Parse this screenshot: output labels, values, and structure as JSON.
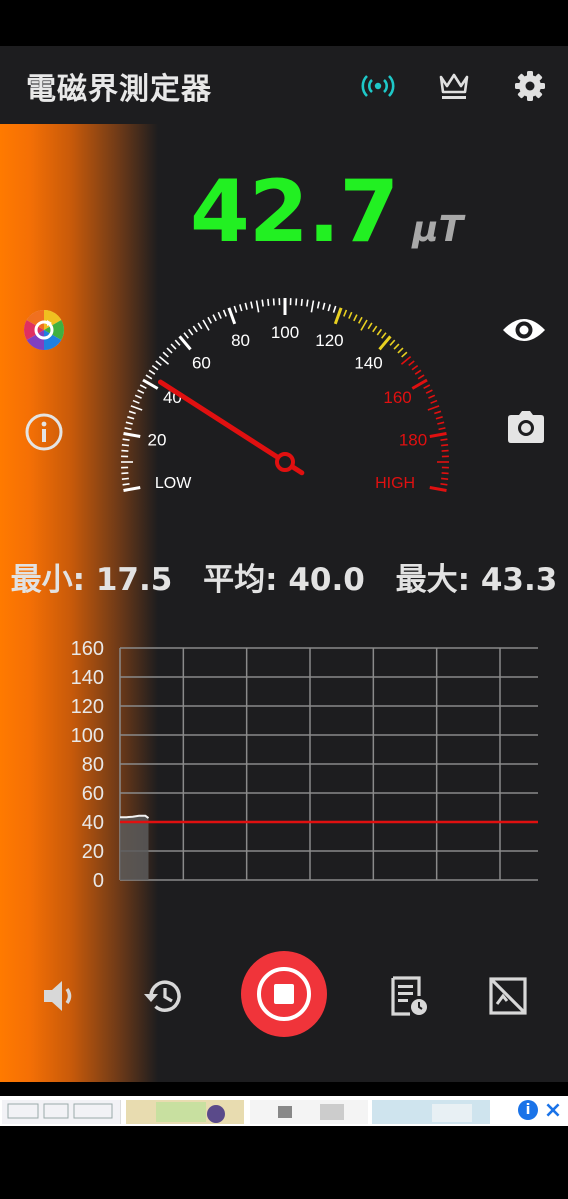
{
  "header": {
    "title": "電磁界測定器"
  },
  "icons": {
    "signal": "signal-broadcast-icon",
    "premium": "crown-icon",
    "settings": "gear-icon",
    "calibrate": "color-wheel-icon",
    "info": "info-icon",
    "view": "eye-icon",
    "camera": "camera-icon",
    "sound": "speaker-icon",
    "history": "history-icon",
    "report": "report-icon",
    "no_overlay": "no-overlay-icon"
  },
  "reading": {
    "value": "42.7",
    "unit": "μT"
  },
  "gauge": {
    "ticks": [
      "20",
      "40",
      "60",
      "80",
      "100",
      "120",
      "140",
      "160",
      "180"
    ],
    "low_label": "LOW",
    "high_label": "HIGH",
    "min": 0,
    "max": 200,
    "needle_value": 42.7
  },
  "stats": {
    "min_label": "最小: 17.5",
    "avg_label": "平均: 40.0",
    "max_label": "最大: 43.3"
  },
  "chart_data": {
    "type": "line",
    "x_ticks": [
      "0",
      "10",
      "20",
      "30",
      "40",
      "50",
      "60"
    ],
    "y_ticks": [
      "160",
      "140",
      "120",
      "100",
      "80",
      "60",
      "40",
      "20",
      "0"
    ],
    "xlim": [
      0,
      66
    ],
    "ylim": [
      0,
      160
    ],
    "series": [
      {
        "x": [
          0,
          1,
          2,
          3,
          4,
          4.5
        ],
        "values": [
          43.3,
          43.3,
          43.6,
          44.3,
          44.3,
          42.7
        ]
      }
    ],
    "average_line": 40.0,
    "grid": true
  },
  "colors": {
    "accent_green": "#22f022",
    "high_red": "#e01010",
    "record_red": "#f0343a",
    "signal_teal": "#1ec8c8",
    "side_orange": "#ff7a00"
  }
}
